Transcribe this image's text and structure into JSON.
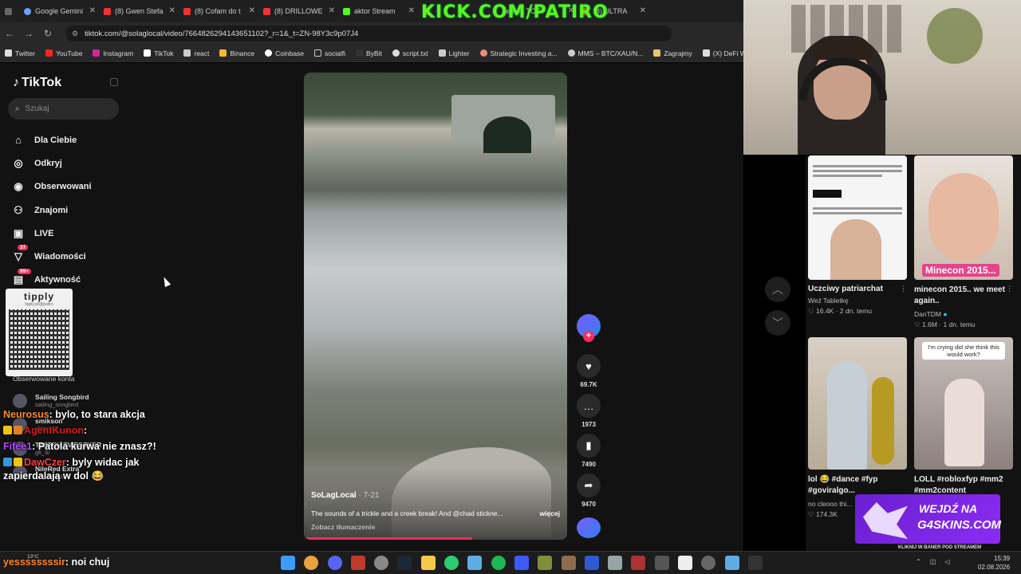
{
  "browser": {
    "tabs": [
      {
        "label": "Google Gemini",
        "icon": "gemini-icon"
      },
      {
        "label": "(8) Gwen Stefa",
        "icon": "youtube-icon"
      },
      {
        "label": "(8) Cofam do t",
        "icon": "youtube-icon"
      },
      {
        "label": "(8) DRILLOWE",
        "icon": "youtube-icon"
      },
      {
        "label": "aktor Stream",
        "icon": "kick-icon"
      },
      {
        "label": "",
        "icon": "youtube-icon"
      },
      {
        "label": "kemon TCG",
        "icon": "youtube-icon"
      },
      {
        "label": "(8) ULTRA",
        "icon": "youtube-icon"
      }
    ],
    "url": "tiktok.com/@solaglocal/video/7664826294143651102?_r=1&_t=ZN-98Y3c9p07J4",
    "bookmarks": [
      "Twitter",
      "YouTube",
      "Instagram",
      "TikTok",
      "react",
      "Binance",
      "Coinbase",
      "socialfi",
      "ByBit",
      "script.txt",
      "Lighter",
      "Strategic Investing a...",
      "MMS – BTC/XAU/N...",
      "Zagrajmy",
      "(X) DeFi Warhol on..."
    ]
  },
  "overlay_banner": "KICK.COM/PATIRO",
  "tiktok": {
    "logo": "TikTok",
    "search_placeholder": "Szukaj",
    "menu": [
      {
        "label": "Dla Ciebie",
        "icon": "home-icon"
      },
      {
        "label": "Odkryj",
        "icon": "compass-icon"
      },
      {
        "label": "Obserwowani",
        "icon": "following-icon"
      },
      {
        "label": "Znajomi",
        "icon": "friends-icon"
      },
      {
        "label": "LIVE",
        "icon": "live-icon"
      },
      {
        "label": "Wiadomości",
        "icon": "messages-icon",
        "badge": "37"
      },
      {
        "label": "Aktywność",
        "icon": "activity-icon",
        "badge": "99+"
      }
    ],
    "qr_title": "tipply",
    "qr_subtitle": "tipply.pl/@patiro",
    "followed_title": "Obserwowane konta",
    "followed": [
      {
        "name": "Sailing Songbird",
        "handle": "sailing_songbird"
      },
      {
        "name": "smikson",
        "handle": "aktor118_"
      },
      {
        "name": "TWITCH.TV/ESZKER",
        "handle": "gfi_6/"
      },
      {
        "name": "NileRed Extra",
        "handle": "nilerdextra"
      }
    ],
    "video": {
      "author": "SoLagLocal",
      "date": "· 7-21",
      "description": "The sounds of a trickle and a creek break! And @chad stickne...",
      "more": "więcej",
      "translate": "Zobacz tłumaczenie",
      "progress": 0.64
    },
    "actions": {
      "likes": "69.7K",
      "comments": "1973",
      "saves": "7490",
      "shares": "9470"
    },
    "recommended": [
      {
        "title": "Uczciwy patriarchat",
        "author": "Weź Tabletkę",
        "likes": "16.4K",
        "time": "2 dn. temu"
      },
      {
        "title": "minecon 2015.. we meet again..",
        "author": "DanTDM",
        "likes": "1.6M",
        "time": "1 dn. temu",
        "overlay": "Minecon 2015..."
      },
      {
        "title": "lol 😂 #dance #fyp #goviralgo...",
        "author": "no cleooo thi...",
        "likes": "174.3K",
        "time": ""
      },
      {
        "title": "LOLL #robloxfyp #mm2 #mm2content",
        "author": "",
        "likes": "",
        "time": "",
        "overlay": "I'm crying did she think this would work?"
      }
    ]
  },
  "chat": [
    {
      "user": "Neurosus",
      "text": ": bylo, to stara akcja"
    },
    {
      "user": "AgentKunon",
      "text": ":"
    },
    {
      "user": "Fifee1",
      "text": ": Patola kurwa nie znasz?!"
    },
    {
      "user": "DawCzer",
      "text": ": byly widac jak zapierdalają w dol 😂"
    }
  ],
  "taskbar_chat": {
    "user": "yessssssssir",
    "text": ": noi chuj"
  },
  "weather": "13°C",
  "ad": {
    "line1": "WEJDŹ NA",
    "line2": "G4SKINS.COM",
    "strip": "KLIKNIJ W BANER POD STREAMEM"
  },
  "clock": {
    "time": "15:39",
    "date": "02.08.2026"
  }
}
